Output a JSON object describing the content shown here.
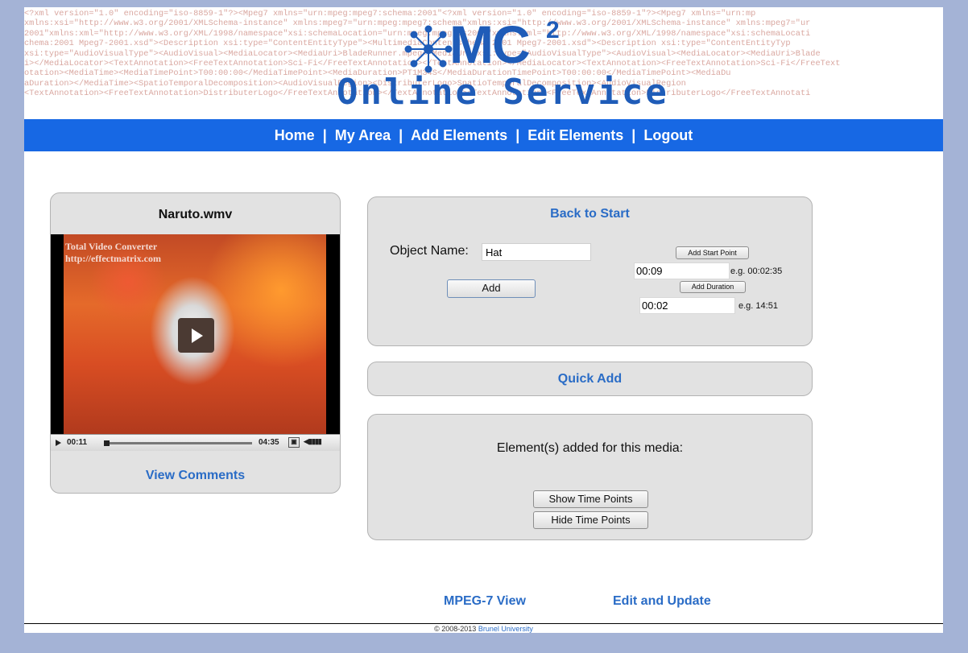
{
  "banner": {
    "xml_lines": [
      "<?xml   version=\"1.0\"   encoding=\"iso-8859-1\"?><Mpeg7   xmlns=\"urn:mpeg:mpeg7:schema:2001\"<?xml   version=\"1.0\"   encoding=\"iso-8859-1\"?><Mpeg7   xmlns=\"urn:mp",
      "xmlns:xsi=\"http://www.w3.org/2001/XMLSchema-instance\" xmlns:mpeg7=\"urn:mpeg:mpeg7:schema\"xmlns:xsi=\"http://www.w3.org/2001/XMLSchema-instance\" xmlns:mpeg7=\"ur",
      "2001\"xmlns:xml=\"http://www.w3.org/XML/1998/namespace\"xsi:schemaLocation=\"urn:mpeg:mpeg7:s2001\"xmlns:xml=\"http://www.w3.org/XML/1998/namespace\"xsi:schemaLocati",
      "chema:2001  Mpeg7-2001.xsd\"><Description   xsi:type=\"ContentEntityType\"><MultimediaContentschema:2001  Mpeg7-2001.xsd\"><Description   xsi:type=\"ContentEntityTyp",
      "xsi:type=\"AudioVisualType\"><AudioVisual><MediaLocator><MediaUri>BladeRunner.mpeg</MediaUri>xsi:type=\"AudioVisualType\"><AudioVisual><MediaLocator><MediaUri>Blade",
      "i></MediaLocator><TextAnnotation><FreeTextAnnotation>Sci-Fi</FreeTextAnnotation></TextAnnotation></MediaLocator><TextAnnotation><FreeTextAnnotation>Sci-Fi</FreeText",
      "otation><MediaTime><MediaTimePoint>T00:00:00</MediaTimePoint><MediaDuration>PT1M34S</MediaDurationTimePoint>T00:00:00</MediaTimePoint><MediaDu",
      "aDuration></MediaTime><SpatioTemporalDecomposition><AudioVisualRegion><DistributerLogo>SpatioTemporalDecomposition><AudioVisualRegion",
      "<TextAnnotation><FreeTextAnnotation>DistributerLogo</FreeTextAnnotation></TextAnnotation><TextAnnotation><FreeTextAnnotation>DistributerLogo</FreeTextAnnotati"
    ],
    "logo_mc": "MC",
    "logo_sup": "2",
    "logo_sub": "Online Service",
    "brand_color": "#1f5cb8"
  },
  "nav": {
    "items": [
      "Home",
      "My Area",
      "Add Elements",
      "Edit Elements",
      "Logout"
    ],
    "separator": "|",
    "bg_color": "#1768e4"
  },
  "video_panel": {
    "title": "Naruto.wmv",
    "watermark_line1": "Total Video Converter",
    "watermark_line2": "http://effectmatrix.com",
    "current_time": "00:11",
    "total_time": "04:35",
    "progress_fraction": 0.04,
    "view_comments": "View Comments"
  },
  "form_panel": {
    "back_to_start": "Back to Start",
    "object_name_label": "Object Name:",
    "object_name_value": "Hat",
    "add_button": "Add",
    "add_start_point_button": "Add Start Point",
    "start_point_value": "00:09",
    "start_point_example": "e.g. 00:02:35",
    "add_duration_button": "Add Duration",
    "duration_value": "00:02",
    "duration_example": "e.g. 14:51"
  },
  "quick_panel": {
    "quick_add": "Quick Add"
  },
  "elements_panel": {
    "label": "Element(s) added for this media:",
    "show_button": "Show Time Points",
    "hide_button": "Hide Time Points"
  },
  "footer": {
    "mpeg7_view": "MPEG-7 View",
    "edit_update": "Edit and Update",
    "copyright_prefix": "© 2008-2013",
    "copyright_org": "Brunel University"
  }
}
